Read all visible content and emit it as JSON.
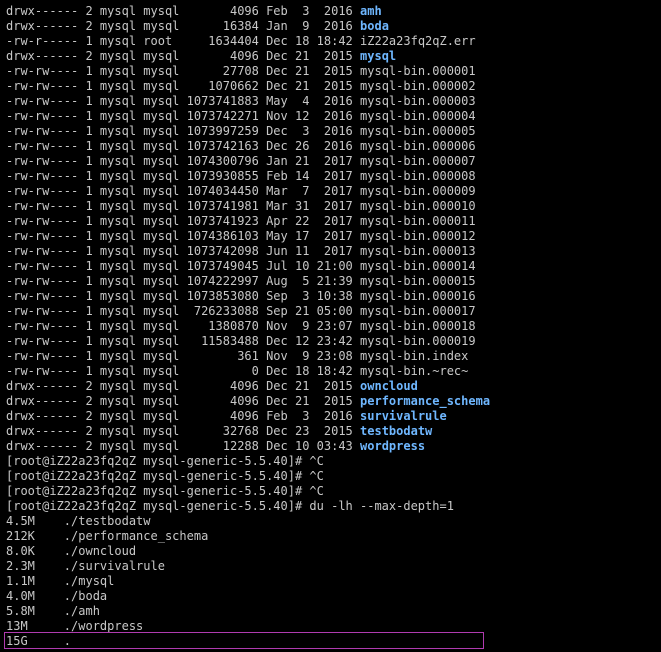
{
  "colors": {
    "background": "#000000",
    "text": "#c8c8c8",
    "directory": "#6fb7ff",
    "cursor_box": "#b03bb0"
  },
  "listing": [
    {
      "meta": "drwx------ 2 mysql mysql       4096 Feb  3  2016 ",
      "name": "amh",
      "is_dir": true
    },
    {
      "meta": "drwx------ 2 mysql mysql      16384 Jan  9  2016 ",
      "name": "boda",
      "is_dir": true
    },
    {
      "meta": "-rw-r----- 1 mysql root     1634404 Dec 18 18:42 ",
      "name": "iZ22a23fq2qZ.err",
      "is_dir": false
    },
    {
      "meta": "drwx------ 2 mysql mysql       4096 Dec 21  2015 ",
      "name": "mysql",
      "is_dir": true
    },
    {
      "meta": "-rw-rw---- 1 mysql mysql      27708 Dec 21  2015 ",
      "name": "mysql-bin.000001",
      "is_dir": false
    },
    {
      "meta": "-rw-rw---- 1 mysql mysql    1070662 Dec 21  2015 ",
      "name": "mysql-bin.000002",
      "is_dir": false
    },
    {
      "meta": "-rw-rw---- 1 mysql mysql 1073741883 May  4  2016 ",
      "name": "mysql-bin.000003",
      "is_dir": false
    },
    {
      "meta": "-rw-rw---- 1 mysql mysql 1073742271 Nov 12  2016 ",
      "name": "mysql-bin.000004",
      "is_dir": false
    },
    {
      "meta": "-rw-rw---- 1 mysql mysql 1073997259 Dec  3  2016 ",
      "name": "mysql-bin.000005",
      "is_dir": false
    },
    {
      "meta": "-rw-rw---- 1 mysql mysql 1073742163 Dec 26  2016 ",
      "name": "mysql-bin.000006",
      "is_dir": false
    },
    {
      "meta": "-rw-rw---- 1 mysql mysql 1074300796 Jan 21  2017 ",
      "name": "mysql-bin.000007",
      "is_dir": false
    },
    {
      "meta": "-rw-rw---- 1 mysql mysql 1073930855 Feb 14  2017 ",
      "name": "mysql-bin.000008",
      "is_dir": false
    },
    {
      "meta": "-rw-rw---- 1 mysql mysql 1074034450 Mar  7  2017 ",
      "name": "mysql-bin.000009",
      "is_dir": false
    },
    {
      "meta": "-rw-rw---- 1 mysql mysql 1073741981 Mar 31  2017 ",
      "name": "mysql-bin.000010",
      "is_dir": false
    },
    {
      "meta": "-rw-rw---- 1 mysql mysql 1073741923 Apr 22  2017 ",
      "name": "mysql-bin.000011",
      "is_dir": false
    },
    {
      "meta": "-rw-rw---- 1 mysql mysql 1074386103 May 17  2017 ",
      "name": "mysql-bin.000012",
      "is_dir": false
    },
    {
      "meta": "-rw-rw---- 1 mysql mysql 1073742098 Jun 11  2017 ",
      "name": "mysql-bin.000013",
      "is_dir": false
    },
    {
      "meta": "-rw-rw---- 1 mysql mysql 1073749045 Jul 10 21:00 ",
      "name": "mysql-bin.000014",
      "is_dir": false
    },
    {
      "meta": "-rw-rw---- 1 mysql mysql 1074222997 Aug  5 21:39 ",
      "name": "mysql-bin.000015",
      "is_dir": false
    },
    {
      "meta": "-rw-rw---- 1 mysql mysql 1073853080 Sep  3 10:38 ",
      "name": "mysql-bin.000016",
      "is_dir": false
    },
    {
      "meta": "-rw-rw---- 1 mysql mysql  726233088 Sep 21 05:00 ",
      "name": "mysql-bin.000017",
      "is_dir": false
    },
    {
      "meta": "-rw-rw---- 1 mysql mysql    1380870 Nov  9 23:07 ",
      "name": "mysql-bin.000018",
      "is_dir": false
    },
    {
      "meta": "-rw-rw---- 1 mysql mysql   11583488 Dec 12 23:42 ",
      "name": "mysql-bin.000019",
      "is_dir": false
    },
    {
      "meta": "-rw-rw---- 1 mysql mysql        361 Nov  9 23:08 ",
      "name": "mysql-bin.index",
      "is_dir": false
    },
    {
      "meta": "-rw-rw---- 1 mysql mysql          0 Dec 18 18:42 ",
      "name": "mysql-bin.~rec~",
      "is_dir": false
    },
    {
      "meta": "drwx------ 2 mysql mysql       4096 Dec 21  2015 ",
      "name": "owncloud",
      "is_dir": true
    },
    {
      "meta": "drwx------ 2 mysql mysql       4096 Dec 21  2015 ",
      "name": "performance_schema",
      "is_dir": true
    },
    {
      "meta": "drwx------ 2 mysql mysql       4096 Feb  3  2016 ",
      "name": "survivalrule",
      "is_dir": true
    },
    {
      "meta": "drwx------ 2 mysql mysql      32768 Dec 23  2015 ",
      "name": "testbodatw",
      "is_dir": true
    },
    {
      "meta": "drwx------ 2 mysql mysql      12288 Dec 10 03:43 ",
      "name": "wordpress",
      "is_dir": true
    }
  ],
  "prompts": [
    "[root@iZ22a23fq2qZ mysql-generic-5.5.40]# ^C",
    "[root@iZ22a23fq2qZ mysql-generic-5.5.40]# ^C",
    "[root@iZ22a23fq2qZ mysql-generic-5.5.40]# ^C",
    "[root@iZ22a23fq2qZ mysql-generic-5.5.40]# du -lh --max-depth=1"
  ],
  "du_output": [
    "4.5M    ./testbodatw",
    "212K    ./performance_schema",
    "8.0K    ./owncloud",
    "2.3M    ./survivalrule",
    "1.1M    ./mysql",
    "4.0M    ./boda",
    "5.8M    ./amh",
    "13M     ./wordpress",
    "15G     ."
  ]
}
